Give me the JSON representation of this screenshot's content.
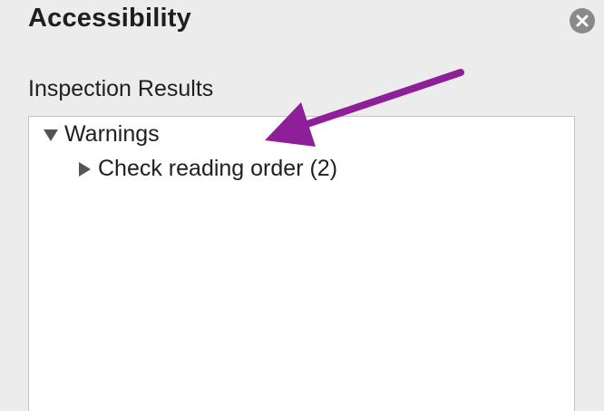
{
  "pane": {
    "title": "Accessibility",
    "close_icon": "close-circle-icon"
  },
  "inspection": {
    "label": "Inspection Results",
    "tree": [
      {
        "label": "Warnings",
        "expanded": true,
        "children": [
          {
            "label": "Check reading order (2)",
            "expanded": false
          }
        ]
      }
    ]
  },
  "annotation": {
    "arrow_color": "#8e1f98"
  }
}
